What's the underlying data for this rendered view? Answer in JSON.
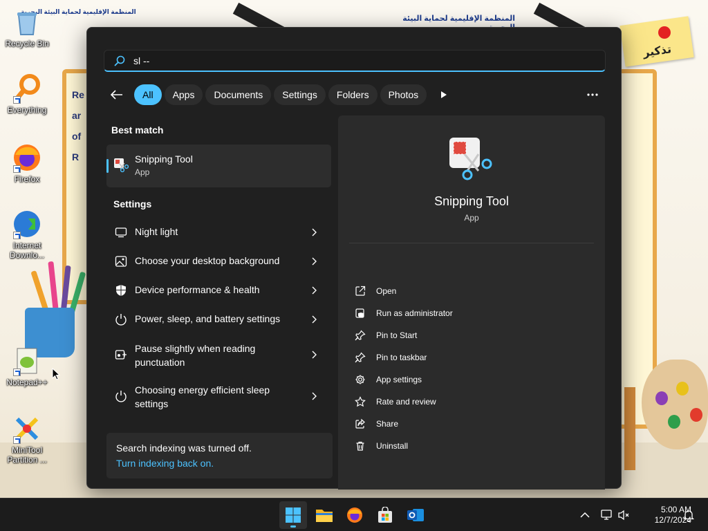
{
  "desktop": {
    "wallpaper": {
      "header_left": "المنظمة الإقليمية لحماية البيئة البحرية",
      "header_right": "المنظمة الإقليمية لحماية البيئة البحرية",
      "note_text": "تذكير",
      "board_text": [
        "Re",
        "ar",
        "of",
        "R"
      ]
    },
    "icons": [
      {
        "label": "Recycle Bin",
        "icon": "recycle-bin-icon"
      },
      {
        "label": "Everything",
        "icon": "everything-search-icon"
      },
      {
        "label": "Firefox",
        "icon": "firefox-icon"
      },
      {
        "label": "Internet Downlo...",
        "icon": "internet-download-manager-icon"
      },
      {
        "label": "Notepad++",
        "icon": "notepad-plus-plus-icon"
      },
      {
        "label": "MiniTool Partition ...",
        "icon": "minitool-partition-icon"
      }
    ]
  },
  "search": {
    "query": "sl --",
    "filters": [
      "All",
      "Apps",
      "Documents",
      "Settings",
      "Folders",
      "Photos"
    ],
    "active_filter": "All",
    "best_match_title": "Best match",
    "best_match": {
      "name": "Snipping Tool",
      "type": "App"
    },
    "settings_title": "Settings",
    "settings_results": [
      {
        "label": "Night light",
        "icon": "monitor-icon"
      },
      {
        "label": "Choose your desktop background",
        "icon": "picture-icon"
      },
      {
        "label": "Device performance & health",
        "icon": "shield-icon"
      },
      {
        "label": "Power, sleep, and battery settings",
        "icon": "power-icon"
      },
      {
        "label": "Pause slightly when reading punctuation",
        "icon": "narrator-icon"
      },
      {
        "label": "Choosing energy efficient sleep settings",
        "icon": "power-icon"
      }
    ],
    "indexing_message": "Search indexing was turned off.",
    "indexing_link": "Turn indexing back on.",
    "detail": {
      "name": "Snipping Tool",
      "type": "App",
      "actions": [
        {
          "label": "Open",
          "icon": "open-external-icon"
        },
        {
          "label": "Run as administrator",
          "icon": "admin-shield-icon"
        },
        {
          "label": "Pin to Start",
          "icon": "pin-icon"
        },
        {
          "label": "Pin to taskbar",
          "icon": "pin-icon"
        },
        {
          "label": "App settings",
          "icon": "gear-icon"
        },
        {
          "label": "Rate and review",
          "icon": "star-icon"
        },
        {
          "label": "Share",
          "icon": "share-icon"
        },
        {
          "label": "Uninstall",
          "icon": "trash-icon"
        }
      ]
    }
  },
  "taskbar": {
    "apps": [
      "Start",
      "File Explorer",
      "Firefox",
      "Microsoft Store",
      "Outlook"
    ],
    "time": "5:00 AM",
    "date": "12/7/2024"
  },
  "colors": {
    "accent": "#4cc2ff",
    "panel": "#202020",
    "detail_pane": "#2b2b2b"
  }
}
